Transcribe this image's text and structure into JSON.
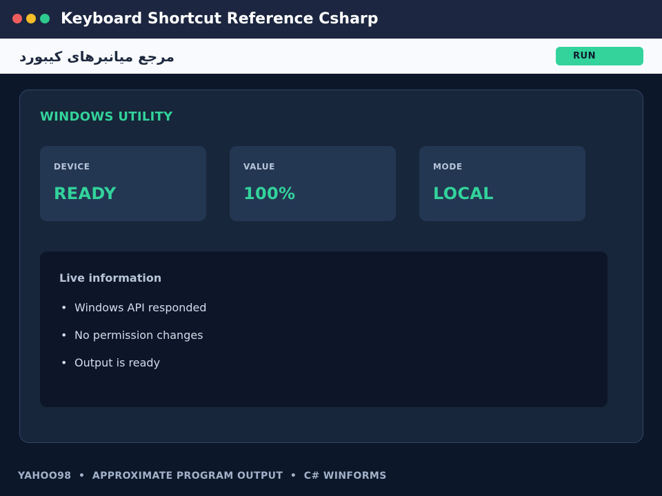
{
  "window": {
    "title": "Keyboard Shortcut Reference Csharp",
    "controls": [
      "close",
      "minimize",
      "maximize"
    ]
  },
  "header": {
    "rtl_title": "مرجع میانبرهای کیبورد",
    "run_label": "RUN"
  },
  "panel": {
    "section_title": "WINDOWS UTILITY",
    "cards": [
      {
        "label": "DEVICE",
        "value": "READY"
      },
      {
        "label": "VALUE",
        "value": "100%"
      },
      {
        "label": "MODE",
        "value": "LOCAL"
      }
    ],
    "info": {
      "title": "Live information",
      "items": [
        "Windows API responded",
        "No permission changes",
        "Output is ready"
      ]
    }
  },
  "footer": {
    "text": "YAHOO98  •  APPROXIMATE PROGRAM OUTPUT  •  C# WINFORMS"
  },
  "colors": {
    "accent": "#33d39b",
    "background": "#0d172a",
    "titlebar": "#1c2640",
    "panel": "#17263a",
    "card": "#233753"
  }
}
